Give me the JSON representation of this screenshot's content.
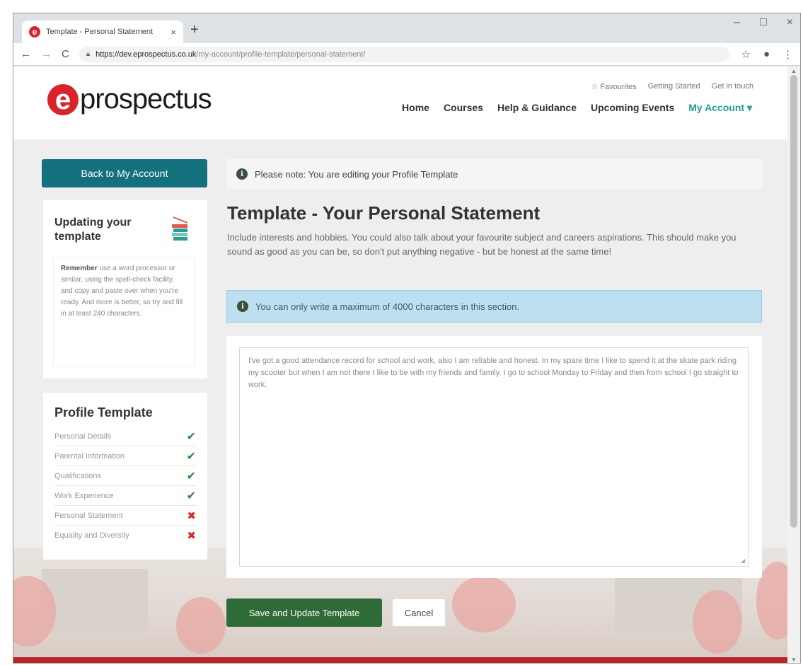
{
  "browser": {
    "tab_title": "Template - Personal Statement",
    "tab_close": "×",
    "new_tab": "+",
    "url_host": "https://dev.eprospectus.co.uk",
    "url_path": "/my-account/profile-template/personal-statement/",
    "window_controls": {
      "minimize": "–",
      "maximize": "□",
      "close": "×"
    },
    "nav": {
      "back": "←",
      "forward": "→",
      "reload": "C"
    }
  },
  "header": {
    "logo_mark": "e",
    "logo_text": "prospectus",
    "top_links": {
      "favourites": "☆ Favourites",
      "getting_started": "Getting Started",
      "get_in_touch": "Get in touch"
    },
    "nav": {
      "home": "Home",
      "courses": "Courses",
      "help": "Help & Guidance",
      "events": "Upcoming Events",
      "account": "My Account ▾"
    },
    "accent_color": "#2a9d8f"
  },
  "sidebar": {
    "back_button": "Back to My Account",
    "updating": {
      "title": "Updating your template",
      "tip_bold": "Remember",
      "tip_text": " use a word processor or similar, using the spell-check facility, and copy and paste over when you're ready. And more is better, so try and fill in at least 240 characters."
    },
    "profile": {
      "title": "Profile Template",
      "items": [
        {
          "label": "Personal Details",
          "status": "✔"
        },
        {
          "label": "Parental Information",
          "status": "✔"
        },
        {
          "label": "Qualifications",
          "status": "✔"
        },
        {
          "label": "Work Experience",
          "status": "✔"
        },
        {
          "label": "Personal Statement",
          "status": "✖"
        },
        {
          "label": "Equality and Diversity",
          "status": "✖"
        }
      ]
    }
  },
  "main": {
    "note": "Please note: You are editing your Profile Template",
    "title": "Template - Your Personal Statement",
    "description": "Include interests and hobbies. You could also talk about your favourite subject and careers aspirations. This should make you sound as good as you can be, so don't put anything negative - but be honest at the same time!",
    "alert": "You can only write a maximum of 4000 characters in this section.",
    "statement_text": "I've got a good attendance record for school and work, also I am reliable and honest. In my spare time I like to spend it at the skate park riding my scooter but when I am not there I like to be with my friends and family. I go to school Monday to Friday and then from school I go straight to work.",
    "save_button": "Save and Update Template",
    "cancel_button": "Cancel"
  },
  "colors": {
    "primary_teal": "#15707e",
    "save_green": "#2f6b36",
    "brand_red": "#d8232a",
    "alert_blue": "#bde0f1"
  }
}
